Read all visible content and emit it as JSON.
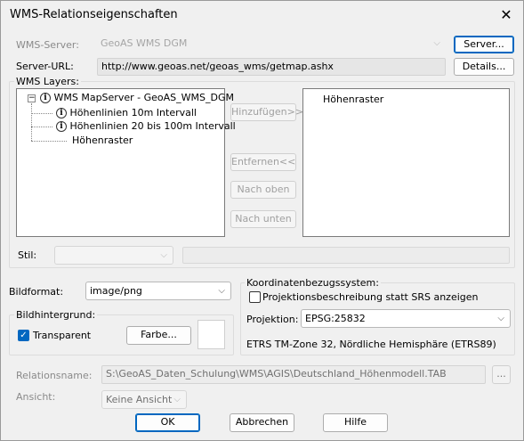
{
  "window": {
    "title": "WMS-Relationseigenschaften",
    "close_glyph": "✕"
  },
  "server": {
    "label": "WMS-Server:",
    "value": "GeoAS WMS DGM",
    "button": "Server...",
    "url_label": "Server-URL:",
    "url_value": "http://www.geoas.net/geoas_wms/getmap.ashx",
    "details_button": "Details..."
  },
  "layers": {
    "group_label": "WMS Layers:",
    "tree": [
      {
        "label": "WMS MapServer - GeoAS_WMS_DGM",
        "icon": "info-icon"
      },
      {
        "label": "Höhenlinien 10m Intervall",
        "icon": "info-icon"
      },
      {
        "label": "Höhenlinien 20 bis 100m Intervall",
        "icon": "info-icon"
      },
      {
        "label": "Höhenraster",
        "icon": ""
      }
    ],
    "selected": [
      "Höhenraster"
    ],
    "buttons": {
      "add": "Hinzufügen>>",
      "remove": "Entfernen<<",
      "up": "Nach oben",
      "down": "Nach unten"
    },
    "style_label": "Stil:",
    "style_value": ""
  },
  "format": {
    "label": "Bildformat:",
    "value": "image/png"
  },
  "background": {
    "group_label": "Bildhintergrund:",
    "transparent_label": "Transparent",
    "transparent_checked": true,
    "color_button": "Farbe...",
    "swatch_color": "#ffffff"
  },
  "crs": {
    "group_label": "Koordinatenbezugssystem:",
    "checkbox_label": "Projektionsbeschreibung statt SRS anzeigen",
    "checkbox_checked": false,
    "projection_label": "Projektion:",
    "projection_value": "EPSG:25832",
    "description": "ETRS TM-Zone 32, Nördliche Hemisphäre (ETRS89)"
  },
  "relation": {
    "name_label": "Relationsname:",
    "name_value": "S:\\GeoAS_Daten_Schulung\\WMS\\AGIS\\Deutschland_Höhenmodell.TAB",
    "browse_button": "...",
    "view_label": "Ansicht:",
    "view_value": "Keine Ansicht"
  },
  "footer": {
    "ok": "OK",
    "cancel": "Abbrechen",
    "help": "Hilfe"
  },
  "colors": {
    "accent": "#0067c0"
  }
}
